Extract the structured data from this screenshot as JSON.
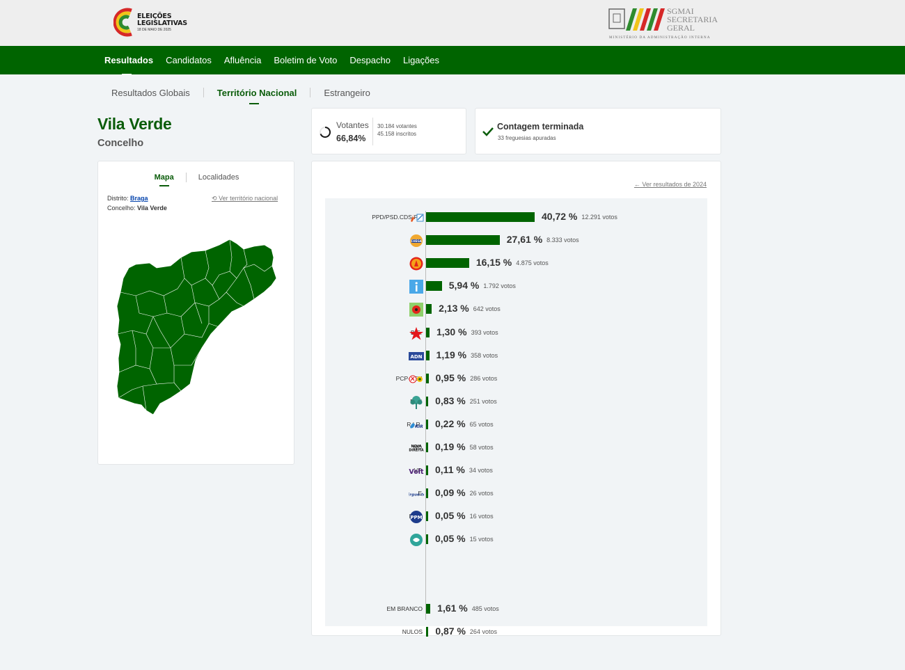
{
  "header": {
    "logo_line1": "ELEIÇÕES",
    "logo_line2": "LEGISLATIVAS",
    "logo_date": "18 DE MAIO DE 2025",
    "sgmai_line1": "SGMAI",
    "sgmai_line2": "SECRETARIA",
    "sgmai_line3": "GERAL",
    "sgmai_sub": "MINISTÉRIO DA ADMINISTRAÇÃO INTERNA"
  },
  "nav": {
    "items": [
      "Resultados",
      "Candidatos",
      "Afluência",
      "Boletim de Voto",
      "Despacho",
      "Ligações"
    ]
  },
  "subtabs": [
    "Resultados Globais",
    "Território Nacional",
    "Estrangeiro"
  ],
  "title": "Vila Verde",
  "subtitle": "Concelho",
  "votantes": {
    "label": "Votantes",
    "pct": "66,84%",
    "votantes_text": "30.184 votantes",
    "inscritos_text": "45.158 inscritos"
  },
  "contagem": {
    "title": "Contagem terminada",
    "sub": "33 freguesias apuradas"
  },
  "map_card": {
    "tabs": [
      "Mapa",
      "Localidades"
    ],
    "distrito_label": "Distrito:",
    "distrito_value": "Braga",
    "concelho_label": "Concelho:",
    "concelho_value": "Vila Verde",
    "ver_territorio": "Ver território nacional"
  },
  "results": {
    "ver_2024": "Ver resultados de 2024"
  },
  "colors": {
    "brand_green": "#006400",
    "bar_green": "#006400",
    "title_green": "#0a5c0a"
  },
  "chart_data": {
    "type": "bar",
    "orientation": "horizontal",
    "categories": [
      "PPD/PSD.CDS-PP",
      "CH",
      "PS",
      "IL",
      "L",
      "B.E.",
      "ADN",
      "PCP-PEV",
      "PAN",
      "R.I.R.",
      "ND",
      "VP",
      "E",
      "PPM",
      "JPP",
      "EM BRANCO",
      "NULOS"
    ],
    "values": [
      40.72,
      27.61,
      16.15,
      5.94,
      2.13,
      1.3,
      1.19,
      0.95,
      0.83,
      0.22,
      0.19,
      0.11,
      0.09,
      0.05,
      0.05,
      1.61,
      0.87
    ],
    "pct_labels": [
      "40,72 %",
      "27,61 %",
      "16,15 %",
      "5,94 %",
      "2,13 %",
      "1,30 %",
      "1,19 %",
      "0,95 %",
      "0,83 %",
      "0,22 %",
      "0,19 %",
      "0,11 %",
      "0,09 %",
      "0,05 %",
      "0,05 %",
      "1,61 %",
      "0,87 %"
    ],
    "votes_labels": [
      "12.291 votos",
      "8.333 votos",
      "4.875 votos",
      "1.792 votos",
      "642 votos",
      "393 votos",
      "358 votos",
      "286 votos",
      "251 votos",
      "65 votos",
      "58 votos",
      "34 votos",
      "26 votos",
      "16 votos",
      "15 votos",
      "485 votos",
      "264 votos"
    ],
    "logos": [
      "ad-logo",
      "chega-logo",
      "ps-logo",
      "il-logo",
      "livre-logo",
      "be-logo",
      "adn-logo",
      "pcp-pev-logo",
      "pan-logo",
      "rir-logo",
      "nd-logo",
      "volt-logo",
      "ergue-te-logo",
      "ppm-logo",
      "jpp-logo",
      "",
      ""
    ]
  }
}
